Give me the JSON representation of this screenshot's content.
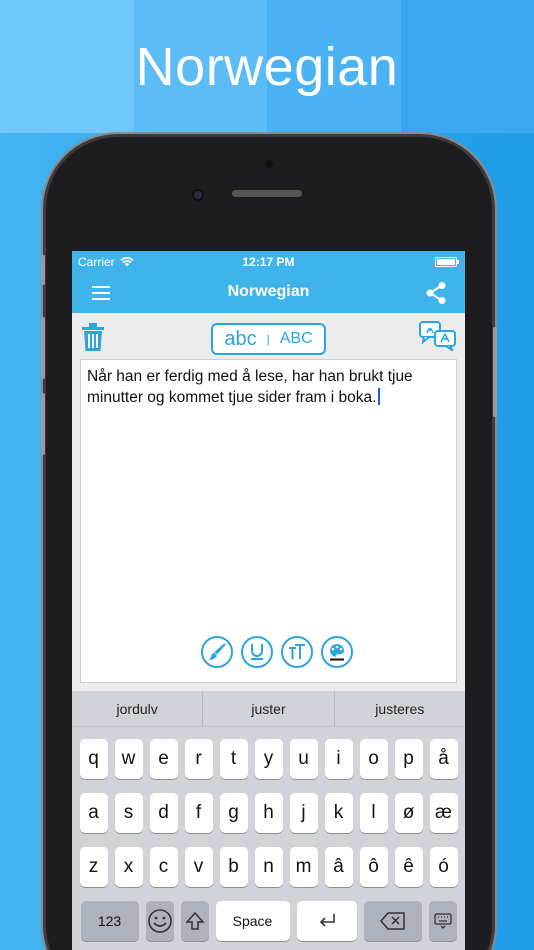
{
  "promo": {
    "title": "Norwegian"
  },
  "status": {
    "carrier": "Carrier",
    "time": "12:17 PM"
  },
  "nav": {
    "title": "Norwegian"
  },
  "toolbar": {
    "case_lower": "abc",
    "case_sep": "|",
    "case_upper": "ABC"
  },
  "editor": {
    "text": "Når han er ferdig med å lese, har han brukt tjue minutter og kommet tjue sider fram i boka."
  },
  "suggestions": [
    "jordulv",
    "juster",
    "justeres"
  ],
  "keyboard": {
    "row1": [
      "q",
      "w",
      "e",
      "r",
      "t",
      "y",
      "u",
      "i",
      "o",
      "p",
      "å"
    ],
    "row2": [
      "a",
      "s",
      "d",
      "f",
      "g",
      "h",
      "j",
      "k",
      "l",
      "ø",
      "æ"
    ],
    "row3": [
      "z",
      "x",
      "c",
      "v",
      "b",
      "n",
      "m",
      "â",
      "ô",
      "ê",
      "ó"
    ],
    "numbers_label": "123",
    "space_label": "Space"
  },
  "colors": {
    "accent": "#2aa5e0",
    "navbar": "#3fb4ea"
  }
}
